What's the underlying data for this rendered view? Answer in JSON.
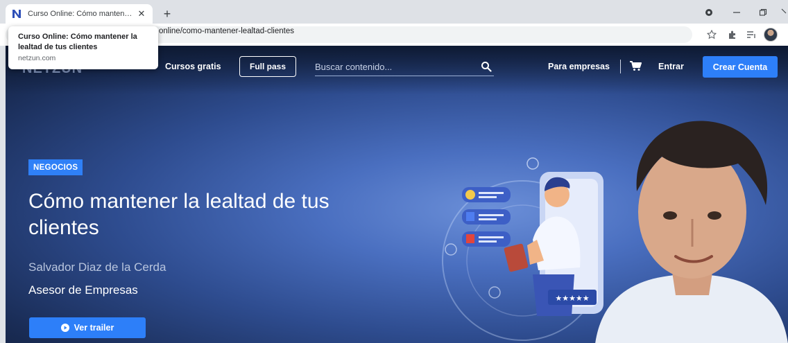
{
  "browser": {
    "tab_title": "Curso Online: Cómo mantener la lealtad de tus clientes",
    "tab_close": "✕",
    "new_tab": "+",
    "url_visible": "online/como-mantener-lealtad-clientes",
    "hover_card": {
      "title": "Curso Online: Cómo mantener la lealtad de tus clientes",
      "domain": "netzun.com"
    },
    "icons": [
      "netzun-favicon",
      "record-icon",
      "minimize-icon",
      "restore-icon",
      "star-icon",
      "extensions-icon",
      "reading-list-icon",
      "profile-avatar"
    ]
  },
  "site": {
    "logo": "NETZUN",
    "nav": {
      "free_courses": "Cursos gratis",
      "full_pass": "Full pass",
      "search_placeholder": "Buscar contenido...",
      "business": "Para empresas",
      "login": "Entrar",
      "signup": "Crear Cuenta"
    }
  },
  "hero": {
    "category": "NEGOCIOS",
    "title": "Cómo mantener la lealtad de tus clientes",
    "instructor": "Salvador Diaz de la Cerda",
    "instructor_role": "Asesor de Empresas",
    "trailer_button": "Ver trailer",
    "rating_stars": 5
  },
  "colors": {
    "accent": "#2d7ff9",
    "badge": "#2f80f7",
    "hero_dark": "#13213f",
    "hero_light": "#6b8fd8"
  }
}
